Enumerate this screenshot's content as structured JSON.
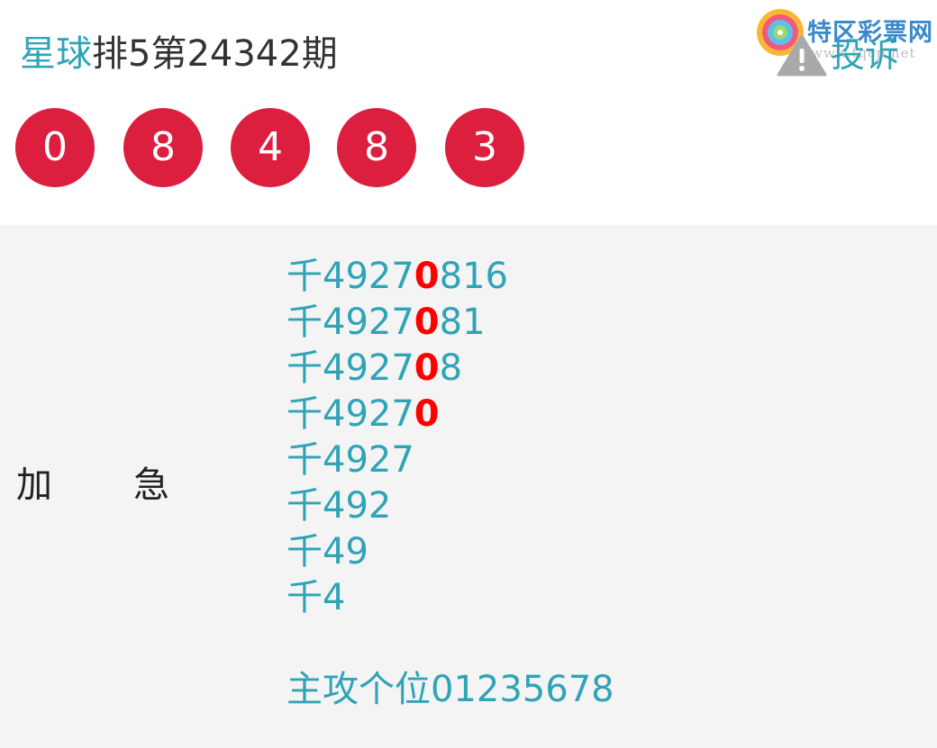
{
  "header": {
    "title_brand": "星球",
    "title_rest": "排5第24342期",
    "complain_label": "投诉",
    "warning_icon": "warning-triangle-icon",
    "accent_color": "#2fa4b6",
    "watermark": {
      "logo_icon": "lollipop-logo-icon",
      "name": "特区彩票网",
      "url": "www.tqcp.net"
    }
  },
  "draw": {
    "numbers": [
      "0",
      "8",
      "4",
      "8",
      "3"
    ],
    "ball_color": "#dc1f3f"
  },
  "panel": {
    "label_1": "加",
    "label_2": "急",
    "picks": [
      {
        "pre": "千4927",
        "hl": "0",
        "post": "816"
      },
      {
        "pre": "千4927",
        "hl": "0",
        "post": "81"
      },
      {
        "pre": "千4927",
        "hl": "0",
        "post": "8"
      },
      {
        "pre": "千4927",
        "hl": "0",
        "post": ""
      },
      {
        "pre": "千4927",
        "hl": "",
        "post": ""
      },
      {
        "pre": "千492",
        "hl": "",
        "post": ""
      },
      {
        "pre": "千49",
        "hl": "",
        "post": ""
      },
      {
        "pre": "千4",
        "hl": "",
        "post": ""
      }
    ],
    "main_attack": "主攻个位01235678",
    "highlight_color": "#ff0000"
  }
}
